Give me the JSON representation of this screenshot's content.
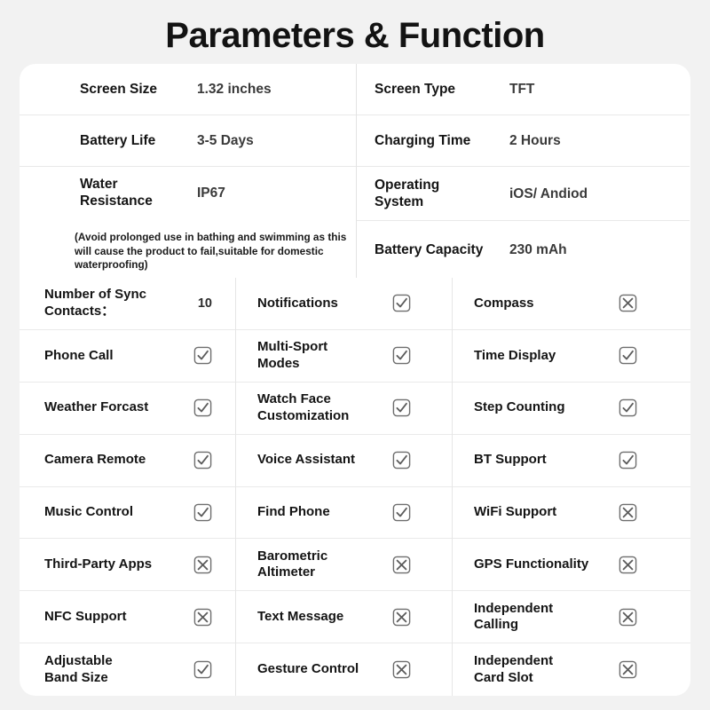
{
  "page": {
    "title": "Parameters & Function",
    "background_color": "#f2f2f2",
    "card_color": "#ffffff",
    "text_color": "#141414",
    "mark_color": "#6e6e6e"
  },
  "spec_table": {
    "left_column": [
      {
        "label": "Screen Size",
        "value": "1.32 inches"
      },
      {
        "label": "Battery Life",
        "value": "3-5 Days"
      },
      {
        "label": "Water\nResistance",
        "label_line1": "Water",
        "label_line2": "Resistance",
        "value": "IP67"
      }
    ],
    "left_note": "(Avoid prolonged use in bathing and swimming as this will cause the product to fail,suitable for domestic waterproofing)",
    "right_column": [
      {
        "label": "Screen Type",
        "value": "TFT"
      },
      {
        "label": "Charging Time",
        "value": "2 Hours"
      },
      {
        "label_line1": "Operating",
        "label_line2": "System",
        "value": "iOS/ Andiod"
      },
      {
        "label": "Battery Capacity",
        "value": "230 mAh"
      }
    ]
  },
  "features": {
    "column1": [
      {
        "label_line1": "Number of Sync",
        "label_line2": "Contacts：",
        "type": "text",
        "value": "10"
      },
      {
        "label": "Phone Call",
        "type": "check"
      },
      {
        "label": "Weather Forcast",
        "type": "check"
      },
      {
        "label": "Camera Remote",
        "type": "check"
      },
      {
        "label": "Music Control",
        "type": "check"
      },
      {
        "label": "Third-Party Apps",
        "type": "cross"
      },
      {
        "label": "NFC Support",
        "type": "cross"
      },
      {
        "label_line1": "Adjustable",
        "label_line2": "Band Size",
        "type": "check"
      }
    ],
    "column2": [
      {
        "label": "Notifications",
        "type": "check"
      },
      {
        "label_line1": "Multi-Sport",
        "label_line2": "Modes",
        "type": "check"
      },
      {
        "label_line1": "Watch Face",
        "label_line2": "Customization",
        "type": "check"
      },
      {
        "label": "Voice Assistant",
        "type": "check"
      },
      {
        "label": "Find Phone",
        "type": "check"
      },
      {
        "label_line1": "Barometric",
        "label_line2": "Altimeter",
        "type": "cross"
      },
      {
        "label": "Text Message",
        "type": "cross"
      },
      {
        "label": "Gesture Control",
        "type": "cross"
      }
    ],
    "column3": [
      {
        "label": "Compass",
        "type": "cross"
      },
      {
        "label": "Time Display",
        "type": "check"
      },
      {
        "label": "Step Counting",
        "type": "check"
      },
      {
        "label": "BT Support",
        "type": "check"
      },
      {
        "label": "WiFi Support",
        "type": "cross"
      },
      {
        "label": "GPS Functionality",
        "type": "cross"
      },
      {
        "label_line1": "Independent",
        "label_line2": "Calling",
        "type": "cross"
      },
      {
        "label_line1": "Independent",
        "label_line2": "Card Slot",
        "type": "cross"
      }
    ]
  },
  "icons": {
    "check": "checkbox-checked-icon",
    "cross": "checkbox-crossed-icon"
  }
}
